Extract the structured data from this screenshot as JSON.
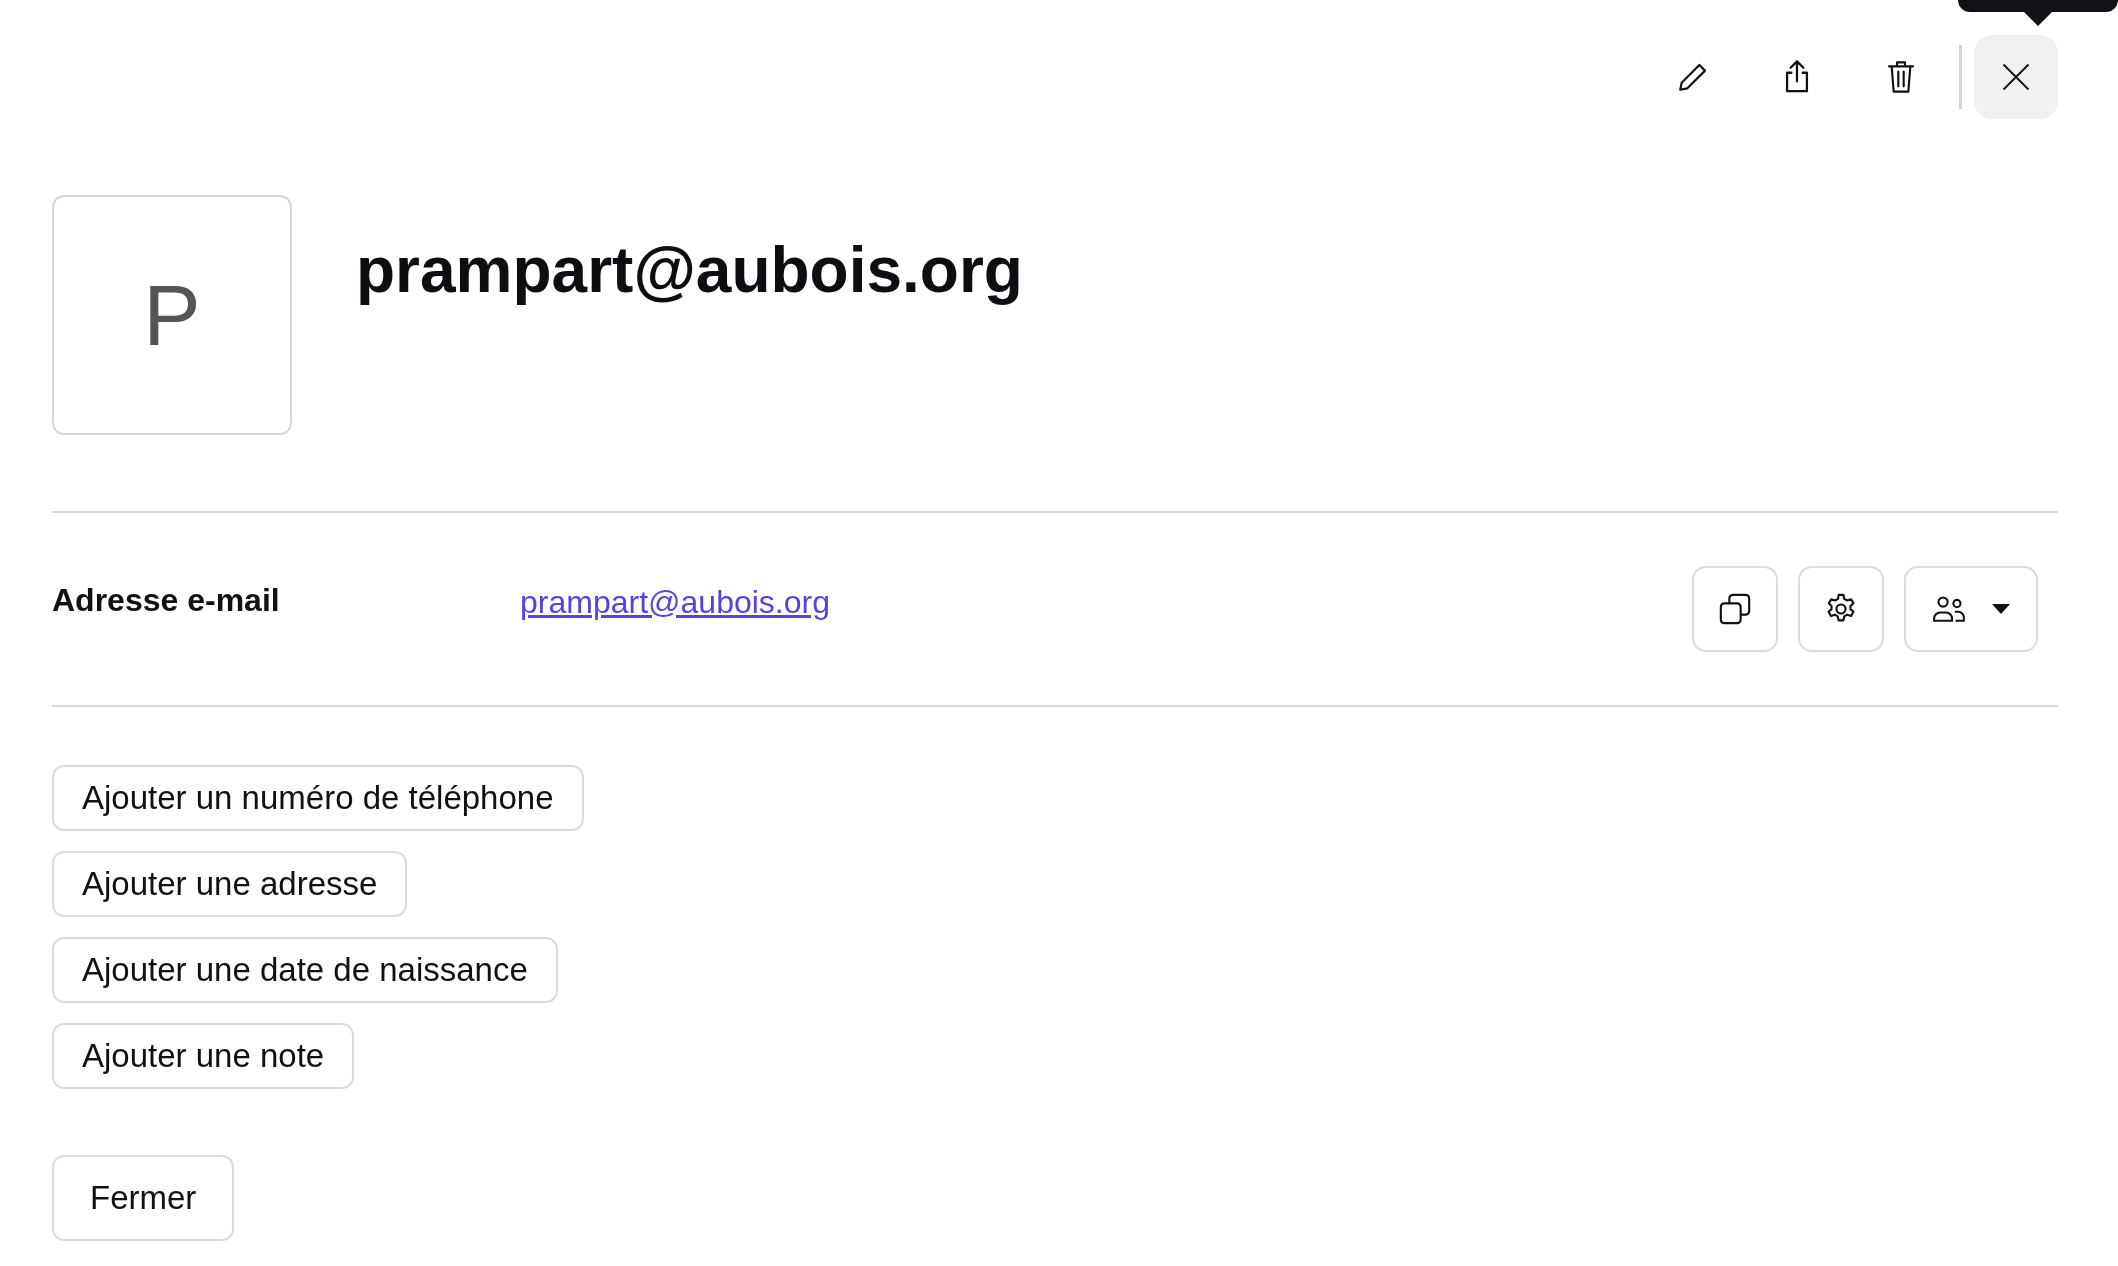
{
  "toolbar": [
    {
      "kind": "edit"
    },
    {
      "kind": "share"
    },
    {
      "kind": "delete"
    },
    {
      "kind": "close"
    }
  ],
  "contact": {
    "initial": "P",
    "title": "prampart@aubois.org"
  },
  "email": {
    "label": "Adresse e-mail",
    "value": "prampart@aubois.org",
    "actions": [
      {
        "kind": "copy"
      },
      {
        "kind": "settings"
      },
      {
        "kind": "share-with"
      }
    ]
  },
  "add_buttons": [
    "Ajouter un numéro de téléphone",
    "Ajouter une adresse",
    "Ajouter une date de naissance",
    "Ajouter une note"
  ],
  "footer": {
    "close_label": "Fermer"
  }
}
